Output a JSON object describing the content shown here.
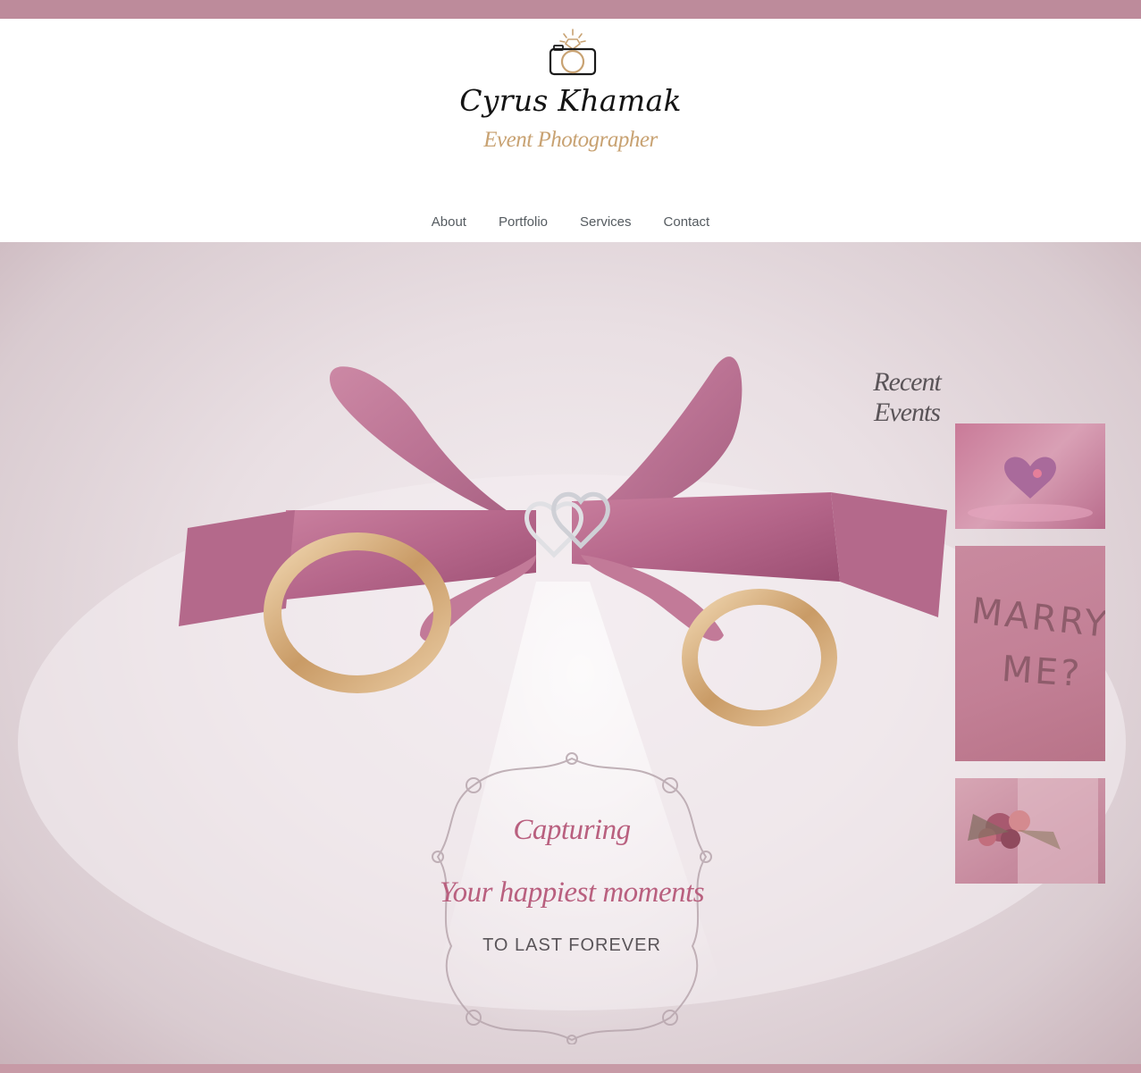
{
  "brand": {
    "name": "Cyrus Khamak",
    "tagline": "Event Photographer",
    "logo_icon": "camera-ring-icon",
    "accent_color": "#bd8b9b",
    "gold_color": "#c8a272"
  },
  "nav": {
    "items": [
      {
        "label": "About"
      },
      {
        "label": "Portfolio"
      },
      {
        "label": "Services"
      },
      {
        "label": "Contact"
      }
    ]
  },
  "hero": {
    "image": "wedding-rings-with-pink-ribbon",
    "caption_line1": "Capturing",
    "caption_line2": "Your happiest moments",
    "caption_line3": "TO LAST FOREVER",
    "caption_color": "#b9607f"
  },
  "recent_events": {
    "title": "Recent Events",
    "thumbnails": [
      {
        "image": "heart-ring-on-pink-water"
      },
      {
        "image": "marry-me-written-in-sand",
        "text_line1": "MARRY",
        "text_line2": "ME?"
      },
      {
        "image": "bride-holding-bouquet"
      }
    ]
  }
}
